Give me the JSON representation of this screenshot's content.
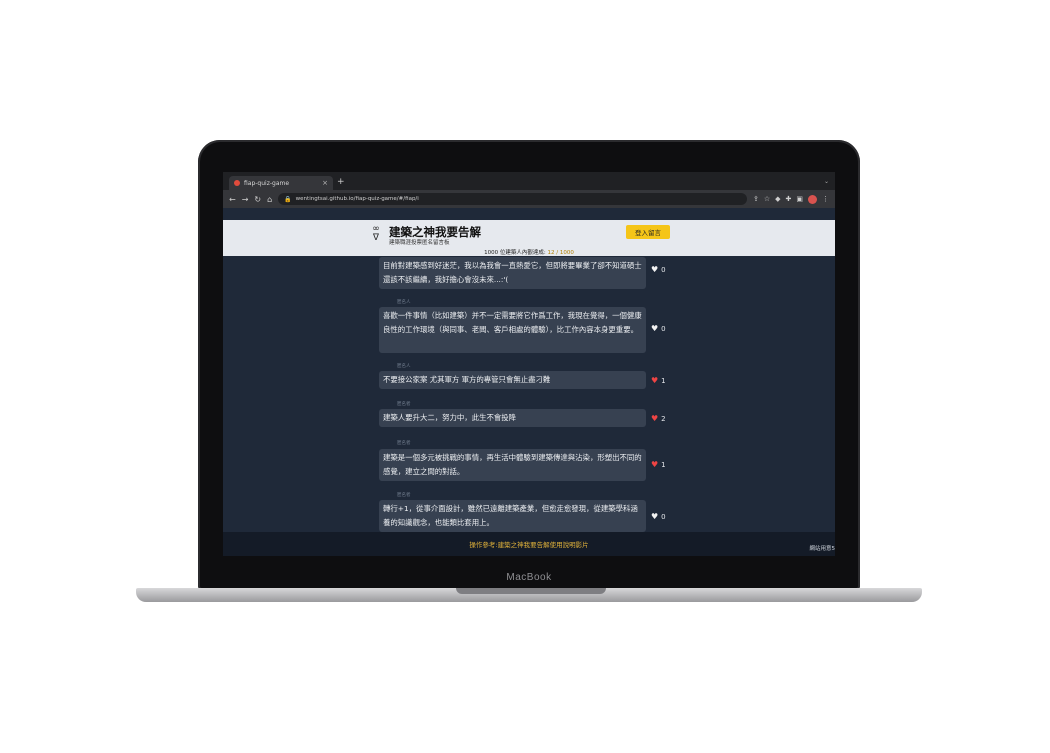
{
  "device": {
    "label": "MacBook"
  },
  "browser": {
    "tab_title": "fiap-quiz-game",
    "tab_close": "×",
    "new_tab": "+",
    "tab_menu": "⌄",
    "url": "wentingtsai.github.io/fiap-quiz-game/#/fiap/i"
  },
  "site": {
    "title": "建築之神我要告解",
    "subtitle": "建築職涯投票匿名留言板",
    "login_label": "登入留言",
    "progress_prefix": "1000 位建築人內觀達成: ",
    "progress_value": "12 / 1000"
  },
  "posts": [
    {
      "meta": "",
      "text": "目前對建築感到好迷茫，我以為我會一直熱愛它，但即將要畢業了卻不知道碩士還該不該繼續，我好擔心會沒未來...:'(",
      "likes": "0",
      "liked": false
    },
    {
      "meta": "匿名人",
      "text": "喜歡一件事情（比如建築）并不一定需要將它作爲工作，我現在覺得，一個健康良性的工作環境（與同事、老闆、客戶相處的體驗），比工作內容本身更重要。",
      "likes": "0",
      "liked": false
    },
    {
      "meta": "匿名人",
      "text": "不要接公家案 尤其軍方 軍方的專管只會無止盡刁難",
      "likes": "1",
      "liked": true
    },
    {
      "meta": "匿名者",
      "text": "建築人要升大二，努力中，此生不會投降",
      "likes": "2",
      "liked": true
    },
    {
      "meta": "匿名者",
      "text": "建築是一個多元被挑戰的事情，再生活中體驗到建築傳達與沾染，形塑出不同的感覺，建立之間的對話。",
      "likes": "1",
      "liked": true
    },
    {
      "meta": "匿名者",
      "text": "轉行+1，從事介面設計，雖然已遠離建築產業，但愈走愈發現，從建築學科涵養的知識觀念，也能類比套用上。",
      "likes": "0",
      "liked": false
    }
  ],
  "footer": {
    "link_text": "操作參考:建築之神我要告解使用說明影片",
    "right_text": "網站用意5"
  },
  "icons": {
    "heart": "♥",
    "like_liked_color": "#ef4444",
    "accent": "#f5c518"
  }
}
